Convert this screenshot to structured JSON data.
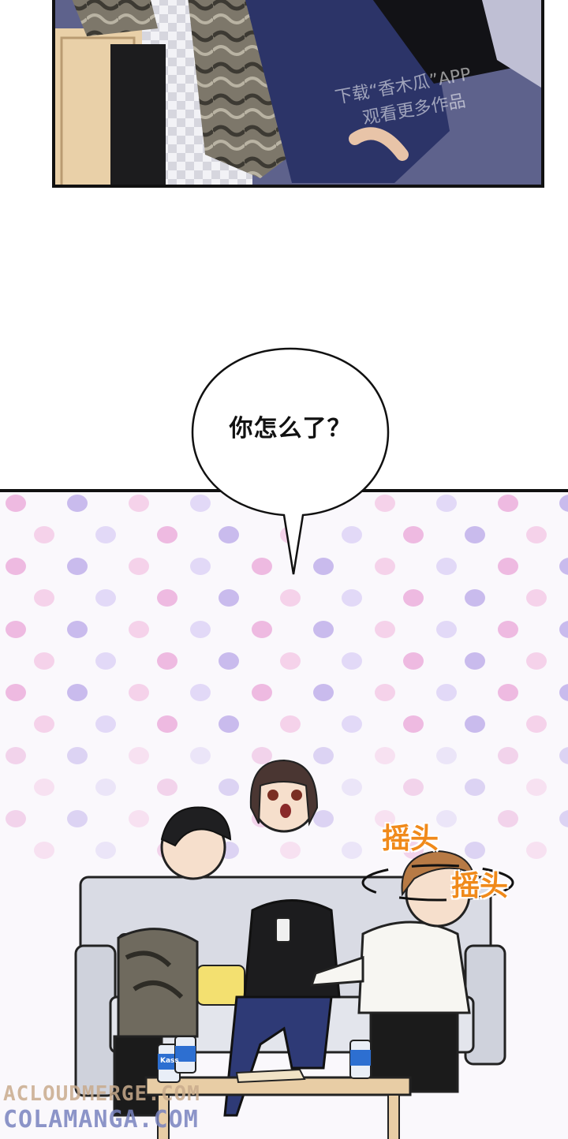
{
  "speech_bubble": {
    "text": "你怎么了？"
  },
  "sfx": {
    "first": "摇头",
    "second": "摇头"
  },
  "watermark": {
    "line1": "下载“香木瓜”APP",
    "line2": "观看更多作品"
  },
  "cans": {
    "label": "Kass"
  },
  "site_marks": {
    "upper": "ACLOUDMERGE.COM",
    "lower": "COLAMANGA.COM"
  },
  "colors": {
    "orange_sfx": "#f08a1a",
    "panel_border": "#111111",
    "dots_pink": "#e9a6d8",
    "dots_violet": "#b8a7e8"
  }
}
